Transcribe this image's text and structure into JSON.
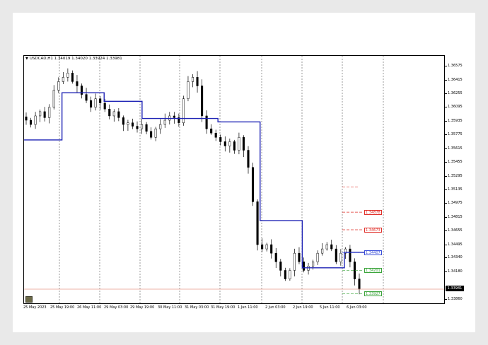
{
  "chart_title": "USDCAD,H1  1.34019 1.34020 1.33924 1.33981",
  "colors": {
    "candles": "#000000",
    "trend_line": "#1f23b5",
    "grid": "#555555",
    "red_level": "#e0302a",
    "blue_level": "#3b4fd9",
    "green_level": "#3aa43a",
    "price_line": "#e89a8a"
  },
  "y_axis_labels": [
    "1.36575",
    "1.36415",
    "1.36255",
    "1.36095",
    "1.35935",
    "1.35775",
    "1.35615",
    "1.35455",
    "1.35295",
    "1.35135",
    "1.34975",
    "1.34815",
    "1.34655",
    "1.34495",
    "1.34340",
    "1.34180",
    "1.33860"
  ],
  "current_price_label": "1.33981",
  "x_axis_labels": [
    "25 May 2023",
    "25 May 19:00",
    "26 May 11:00",
    "29 May 03:00",
    "29 May 19:00",
    "30 May 11:00",
    "31 May 03:00",
    "31 May 19:00",
    "1 Jun 11:00",
    "2 Jun 03:00",
    "2 Jun 19:00",
    "5 Jun 11:00",
    "6 Jun 03:00"
  ],
  "levels": [
    {
      "label": "1.34878",
      "color": "red"
    },
    {
      "label": "1.34673",
      "color": "red"
    },
    {
      "label": "1.34407",
      "color": "blue"
    },
    {
      "label": "1.34201",
      "color": "green"
    },
    {
      "label": "1.33927",
      "color": "green"
    }
  ],
  "chart_data": {
    "type": "candlestick",
    "symbol": "USDCAD",
    "timeframe": "H1",
    "ohlc_last": {
      "open": 1.34019,
      "high": 1.3402,
      "low": 1.33924,
      "close": 1.33981
    },
    "ylim": [
      1.338,
      1.367
    ],
    "close_series": [
      1.3595,
      1.359,
      1.36,
      1.3605,
      1.3598,
      1.361,
      1.363,
      1.364,
      1.3645,
      1.365,
      1.364,
      1.3635,
      1.3625,
      1.3618,
      1.361,
      1.362,
      1.3615,
      1.3608,
      1.36,
      1.3605,
      1.3598,
      1.359,
      1.3592,
      1.3588,
      1.3585,
      1.359,
      1.3582,
      1.3575,
      1.3585,
      1.359,
      1.3595,
      1.36,
      1.3598,
      1.3592,
      1.362,
      1.364,
      1.3645,
      1.3635,
      1.36,
      1.3585,
      1.358,
      1.3575,
      1.357,
      1.3565,
      1.357,
      1.356,
      1.3575,
      1.356,
      1.354,
      1.35,
      1.345,
      1.3445,
      1.345,
      1.344,
      1.343,
      1.342,
      1.341,
      1.342,
      1.344,
      1.343,
      1.342,
      1.3425,
      1.343,
      1.344,
      1.3445,
      1.345,
      1.3445,
      1.343,
      1.344,
      1.3445,
      1.343,
      1.341,
      1.3398
    ],
    "trend_steps": [
      {
        "from": 0.0,
        "to": 0.09,
        "value": 1.3572
      },
      {
        "from": 0.09,
        "to": 0.19,
        "value": 1.3627
      },
      {
        "from": 0.19,
        "to": 0.28,
        "value": 1.3617
      },
      {
        "from": 0.28,
        "to": 0.46,
        "value": 1.3597
      },
      {
        "from": 0.46,
        "to": 0.56,
        "value": 1.3593
      },
      {
        "from": 0.56,
        "to": 0.66,
        "value": 1.3478
      },
      {
        "from": 0.66,
        "to": 0.76,
        "value": 1.3423
      },
      {
        "from": 0.76,
        "to": 0.82,
        "value": 1.3441
      }
    ]
  }
}
